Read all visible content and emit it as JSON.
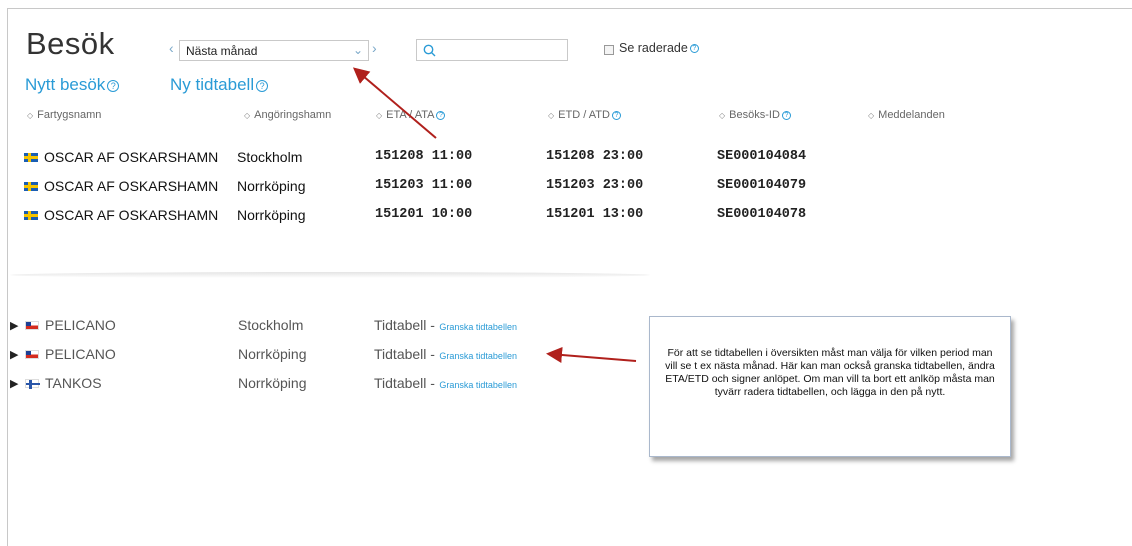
{
  "header": {
    "title": "Besök",
    "period_select": "Nästa månad",
    "search_placeholder": "",
    "show_deleted_label": "Se raderade",
    "new_visit_label": "Nytt besök",
    "new_schedule_label": "Ny tidtabell"
  },
  "columns": {
    "ship_name": "Fartygsnamn",
    "port": "Angöringshamn",
    "eta": "ETA / ATA",
    "etd": "ETD / ATD",
    "visit_id": "Besöks-ID",
    "messages": "Meddelanden"
  },
  "visits": [
    {
      "flag": "se",
      "ship": "OSCAR AF OSKARSHAMN",
      "port": "Stockholm",
      "eta": "151208 11:00",
      "etd": "151208 23:00",
      "id": "SE000104084"
    },
    {
      "flag": "se",
      "ship": "OSCAR AF OSKARSHAMN",
      "port": "Norrköping",
      "eta": "151203 11:00",
      "etd": "151203 23:00",
      "id": "SE000104079"
    },
    {
      "flag": "se",
      "ship": "OSCAR AF OSKARSHAMN",
      "port": "Norrköping",
      "eta": "151201 10:00",
      "etd": "151201 13:00",
      "id": "SE000104078"
    }
  ],
  "schedules": [
    {
      "flag": "cl",
      "ship": "PELICANO",
      "port": "Stockholm",
      "label": "Tidtabell -",
      "link": "Granska tidtabellen"
    },
    {
      "flag": "cl",
      "ship": "PELICANO",
      "port": "Norrköping",
      "label": "Tidtabell -",
      "link": "Granska tidtabellen"
    },
    {
      "flag": "fi",
      "ship": "TANKOS",
      "port": "Norrköping",
      "label": "Tidtabell -",
      "link": "Granska tidtabellen"
    }
  ],
  "callout": {
    "text": "För att se tidtabellen i översikten måst man välja för vilken period man vill se t ex nästa månad. Här kan man också granska tidtabellen, ändra ETA/ETD och signer anlöpet. Om man vill ta bort ett anlköp måsta man tyvärr radera tidtabellen, och lägga in den på nytt."
  },
  "colors": {
    "link": "#2a9bd6",
    "annotation_arrow": "#b0201c"
  },
  "icons": {
    "help": "?",
    "diamond": "◇",
    "prev": "‹",
    "next": "›",
    "expand": "▶"
  }
}
